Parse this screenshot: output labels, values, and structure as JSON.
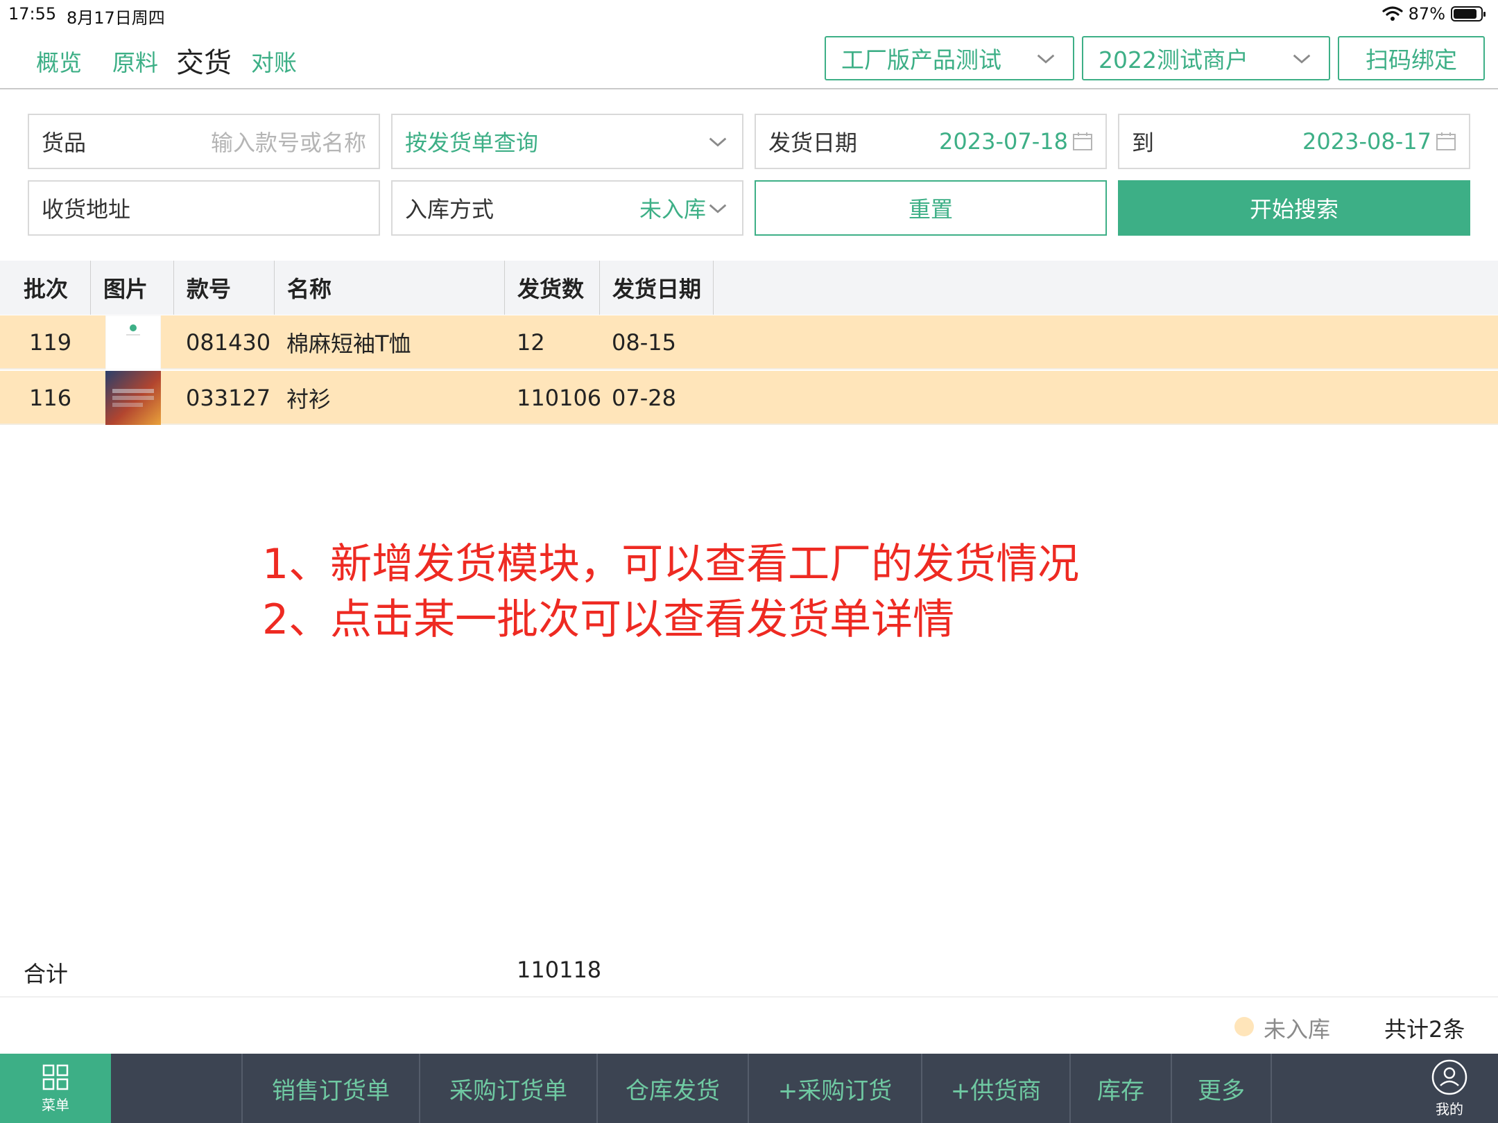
{
  "status_bar": {
    "time": "17:55",
    "date": "8月17日周四",
    "battery": "87%",
    "battery_level": 0.87
  },
  "nav": {
    "tabs": [
      {
        "label": "概览",
        "active": false
      },
      {
        "label": "原料",
        "active": false
      },
      {
        "label": "交货",
        "active": true
      },
      {
        "label": "对账",
        "active": false
      }
    ],
    "factory_select": "工厂版产品测试",
    "merchant_select": "2022测试商户",
    "scan_bind_button": "扫码绑定"
  },
  "filters": {
    "goods": {
      "label": "货品",
      "placeholder": "输入款号或名称"
    },
    "query_mode": "按发货单查询",
    "ship_date": {
      "label": "发货日期",
      "from": "2023-07-18"
    },
    "to": {
      "label": "到",
      "value": "2023-08-17"
    },
    "address": {
      "label": "收货地址"
    },
    "stock_in": {
      "label": "入库方式",
      "value": "未入库"
    },
    "reset_button": "重置",
    "search_button": "开始搜索"
  },
  "table": {
    "columns": [
      "批次",
      "图片",
      "款号",
      "名称",
      "发货数",
      "发货日期"
    ],
    "rows": [
      {
        "batch": "119",
        "style_no": "081430",
        "name": "棉麻短袖T恤",
        "qty": "12",
        "date": "08-15"
      },
      {
        "batch": "116",
        "style_no": "033127",
        "name": "衬衫",
        "qty": "110106",
        "date": "07-28"
      }
    ],
    "total_label": "合计",
    "total_qty": "110118"
  },
  "annotation": {
    "line1": "1、新增发货模块，可以查看工厂的发货情况",
    "line2": "2、点击某一批次可以查看发货单详情"
  },
  "footer": {
    "legend": "未入库",
    "count": "共计2条"
  },
  "bottom_nav": {
    "menu_label": "菜单",
    "items": [
      "销售订货单",
      "采购订货单",
      "仓库发货",
      "+采购订货",
      "+供货商",
      "库存",
      "更多"
    ],
    "me_label": "我的"
  },
  "colors": {
    "accent": "#3daf86",
    "row_highlight": "#ffe5ba",
    "annotation": "#ee2a22",
    "bottom_bar": "#3c4452"
  }
}
